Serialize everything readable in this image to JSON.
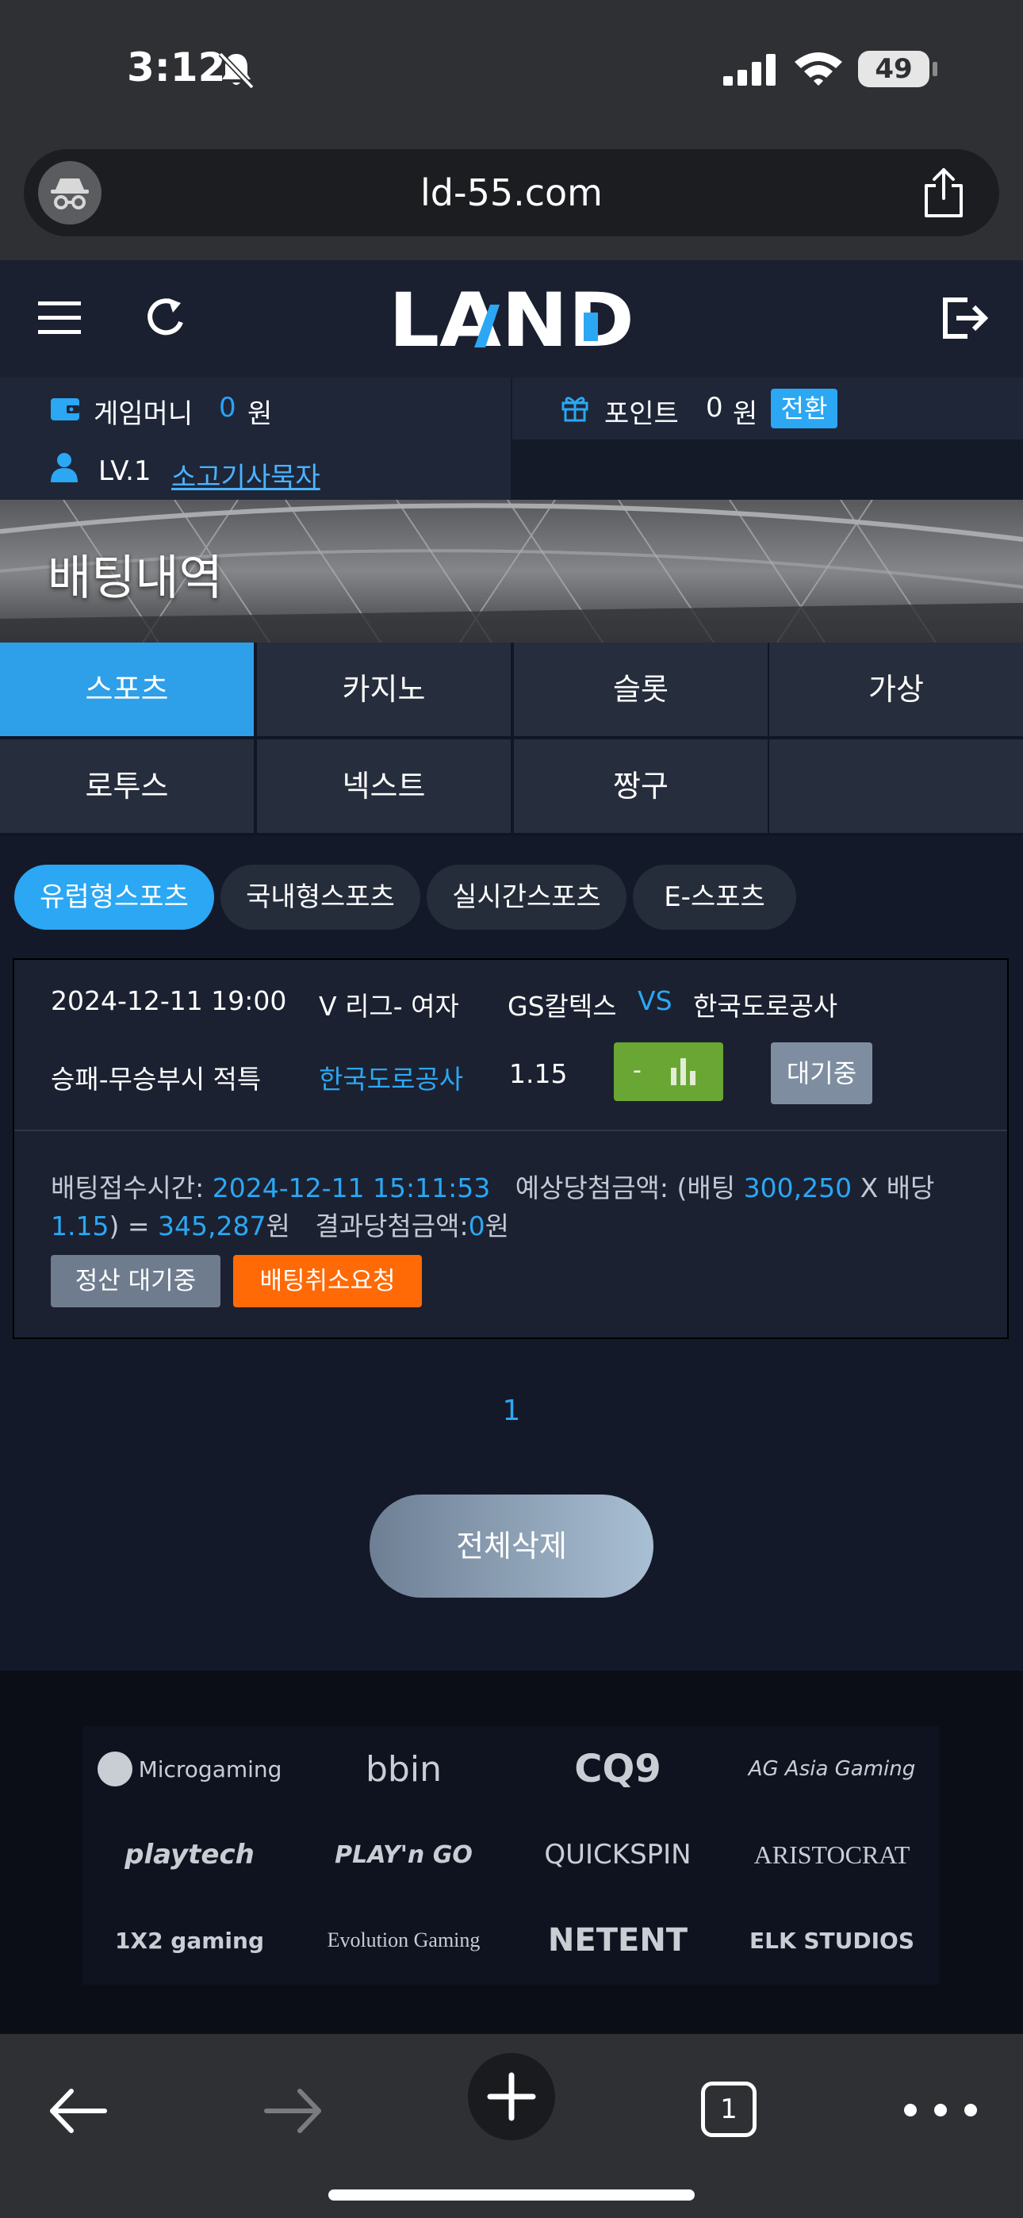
{
  "status_bar": {
    "time": "3:12",
    "battery": "49"
  },
  "browser": {
    "url": "ld-55.com"
  },
  "header": {
    "logo_text": "LAND"
  },
  "account": {
    "game_money_label": "게임머니",
    "game_money_value": "0",
    "game_money_unit": "원",
    "point_label": "포인트",
    "point_value": "0",
    "point_unit": "원",
    "convert_label": "전환",
    "level": "LV.1",
    "username": "소고기사묵자"
  },
  "banner": {
    "title": "배팅내역"
  },
  "tabs": [
    {
      "label": "스포츠",
      "active": true
    },
    {
      "label": "카지노"
    },
    {
      "label": "슬롯"
    },
    {
      "label": "가상"
    },
    {
      "label": "로투스"
    },
    {
      "label": "넥스트"
    },
    {
      "label": "짱구"
    }
  ],
  "sub_tabs": [
    {
      "label": "유럽형스포츠",
      "active": true
    },
    {
      "label": "국내형스포츠"
    },
    {
      "label": "실시간스포츠"
    },
    {
      "label": "E-스포츠"
    }
  ],
  "bet": {
    "datetime": "2024-12-11 19:00",
    "league": "V 리그- 여자",
    "home": "GS칼텍스",
    "vs": "VS",
    "away": "한국도로공사",
    "market": "승패-무승부시 적특",
    "pick": "한국도로공사",
    "odds": "1.15",
    "result_mark": "-",
    "status_button": "대기중",
    "detail": {
      "received_label": "배팅접수시간:",
      "received_time": "2024-12-11  15:11:53",
      "expected_label": "예상당첨금액: (배팅",
      "stake": "300,250",
      "x_label": "X 배당",
      "odds": "1.15",
      "eq": ") =",
      "expected_win": "345,287",
      "won_unit": "원",
      "result_label": "결과당첨금액:",
      "result_value": "0",
      "result_unit": "원"
    },
    "settle_status": "정산  대기중",
    "cancel_label": "배팅취소요청"
  },
  "pagination": {
    "current": "1"
  },
  "delete_all_label": "전체삭제",
  "partners": [
    "Microgaming",
    "bbin",
    "CQ9",
    "AG Asia Gaming",
    "playtech",
    "PLAY'n GO",
    "QUICKSPIN",
    "ARISTOCRAT",
    "1X2 gaming",
    "Evolution Gaming",
    "NETENT",
    "ELK STUDIOS"
  ],
  "toolbar": {
    "tab_count": "1"
  },
  "colors": {
    "accent": "#2ba7f4",
    "active_tab": "#2e9fe9",
    "cancel": "#ff6a06",
    "result_green": "#6aa634"
  }
}
